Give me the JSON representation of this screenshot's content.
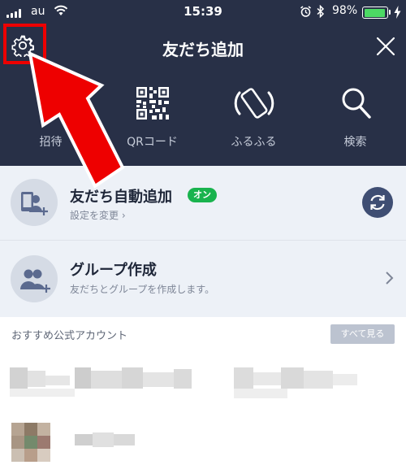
{
  "status_bar": {
    "carrier": "au",
    "time": "15:39",
    "battery": "98%",
    "battery_level": 0.98
  },
  "nav": {
    "title": "友だち追加"
  },
  "methods": [
    {
      "label": "招待",
      "icon": "invite-icon"
    },
    {
      "label": "QRコード",
      "icon": "qr-code-icon"
    },
    {
      "label": "ふるふる",
      "icon": "shake-phone-icon"
    },
    {
      "label": "検索",
      "icon": "search-icon"
    }
  ],
  "auto_add": {
    "title": "友だち自動追加",
    "badge": "オン",
    "subtitle": "設定を変更 ›"
  },
  "group": {
    "title": "グループ作成",
    "subtitle": "友だちとグループを作成します。"
  },
  "recommended": {
    "header": "おすすめ公式アカウント",
    "see_all": "すべて見る"
  },
  "colors": {
    "header_bg": "#283047",
    "row_bg": "#edf1f7",
    "accent_green": "#19b34e",
    "highlight_red": "#ee0000"
  }
}
